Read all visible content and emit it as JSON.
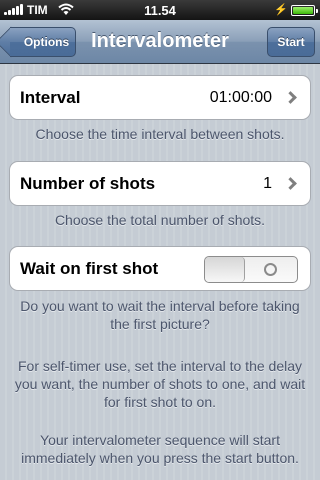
{
  "status_bar": {
    "carrier": "TIM",
    "time": "11.54"
  },
  "nav": {
    "title": "Intervalometer",
    "back_label": "Options",
    "start_label": "Start"
  },
  "interval": {
    "label": "Interval",
    "value": "01:00:00",
    "footer": "Choose the time interval between shots."
  },
  "shots": {
    "label": "Number of shots",
    "value": "1",
    "footer": "Choose the total number of shots."
  },
  "wait": {
    "label": "Wait on first shot",
    "state": "off",
    "footer": "Do you want to wait the interval before taking the first picture?"
  },
  "notes": {
    "self_timer": "For self-timer use, set the interval to the delay you want, the number of shots to one, and wait for first shot to on.",
    "start_info": "Your intervalometer sequence will start immediately when you press the start button."
  }
}
